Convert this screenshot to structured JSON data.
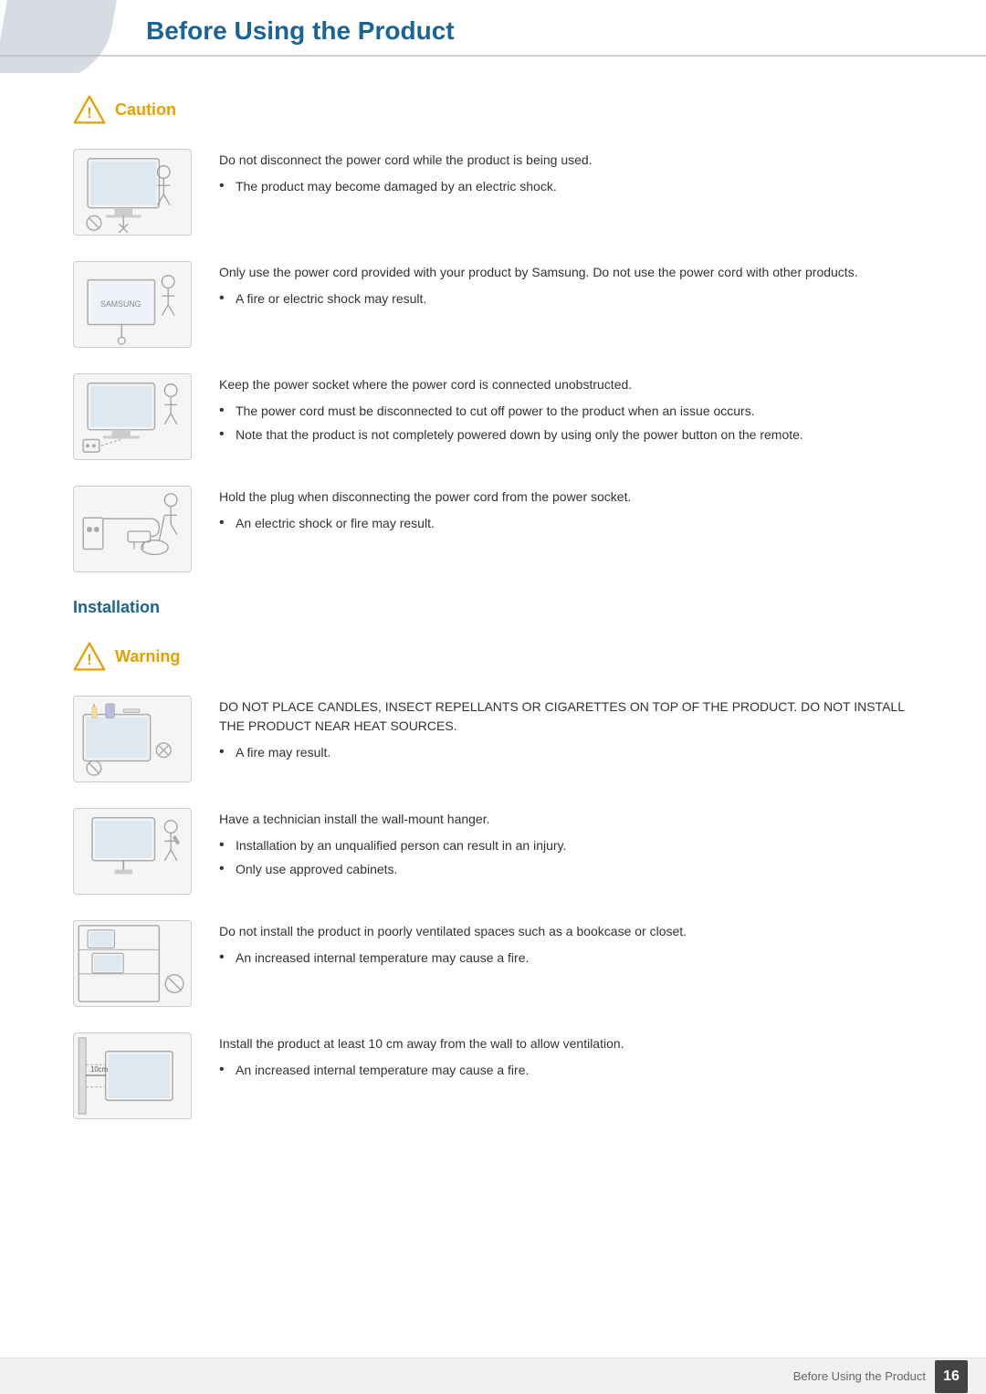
{
  "header": {
    "title": "Before Using the Product"
  },
  "caution": {
    "badge_label": "Caution",
    "items": [
      {
        "id": "caution-1",
        "main_text": "Do not disconnect the power cord while the product is being used.",
        "bullets": [
          "The product may become damaged by an electric shock."
        ]
      },
      {
        "id": "caution-2",
        "main_text": "Only use the power cord provided with your product by Samsung. Do not use the power cord with other products.",
        "bullets": [
          "A fire or electric shock may result."
        ]
      },
      {
        "id": "caution-3",
        "main_text": "Keep the power socket where the power cord is connected unobstructed.",
        "bullets": [
          "The power cord must be disconnected to cut off power to the product when an issue occurs.",
          "Note that the product is not completely powered down by using only the power button on the remote."
        ]
      },
      {
        "id": "caution-4",
        "main_text": "Hold the plug when disconnecting the power cord from the power socket.",
        "bullets": [
          "An electric shock or fire may result."
        ]
      }
    ]
  },
  "installation": {
    "section_title": "Installation",
    "warning": {
      "badge_label": "Warning",
      "items": [
        {
          "id": "warning-1",
          "main_text": "DO NOT PLACE CANDLES, INSECT REPELLANTS OR CIGARETTES ON TOP OF THE PRODUCT. DO NOT INSTALL THE PRODUCT NEAR HEAT SOURCES.",
          "bullets": [
            "A fire may result."
          ]
        },
        {
          "id": "warning-2",
          "main_text": "Have a technician install the wall-mount hanger.",
          "bullets": [
            "Installation by an unqualified person can result in an injury.",
            "Only use approved cabinets."
          ]
        },
        {
          "id": "warning-3",
          "main_text": "Do not install the product in poorly ventilated spaces such as a bookcase or closet.",
          "bullets": [
            "An increased internal temperature may cause a fire."
          ]
        },
        {
          "id": "warning-4",
          "main_text": "Install the product at least 10 cm away from the wall to allow ventilation.",
          "bullets": [
            "An increased internal temperature may cause a fire."
          ]
        }
      ]
    }
  },
  "footer": {
    "label": "Before Using the Product",
    "page_number": "16"
  }
}
